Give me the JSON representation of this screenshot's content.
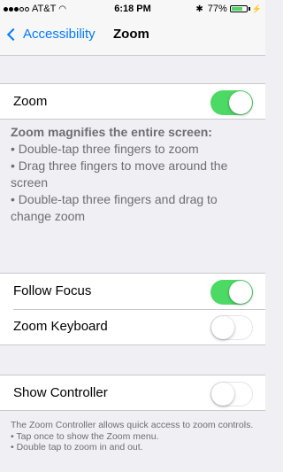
{
  "status_bar": {
    "carrier": "AT&T",
    "time": "6:18 PM",
    "battery_percent": "77%",
    "battery_level": 0.77
  },
  "nav": {
    "back_label": "Accessibility",
    "title": "Zoom"
  },
  "zoom_row": {
    "label": "Zoom",
    "on": true
  },
  "zoom_footer": {
    "heading": "Zoom magnifies the entire screen:",
    "lines": [
      "• Double-tap three fingers to zoom",
      "• Drag three fingers to move around the screen",
      "• Double-tap three fingers and drag to change zoom"
    ]
  },
  "follow_focus": {
    "label": "Follow Focus",
    "on": true
  },
  "zoom_keyboard": {
    "label": "Zoom Keyboard",
    "on": false
  },
  "show_controller": {
    "label": "Show Controller",
    "on": false
  },
  "controller_footer": {
    "lines": [
      "The Zoom Controller allows quick access to zoom controls.",
      "• Tap once to show the Zoom menu.",
      "• Double tap to zoom in and out."
    ]
  },
  "colors": {
    "accent": "#007aff",
    "toggle_on": "#4cd964",
    "background": "#efeff4"
  }
}
